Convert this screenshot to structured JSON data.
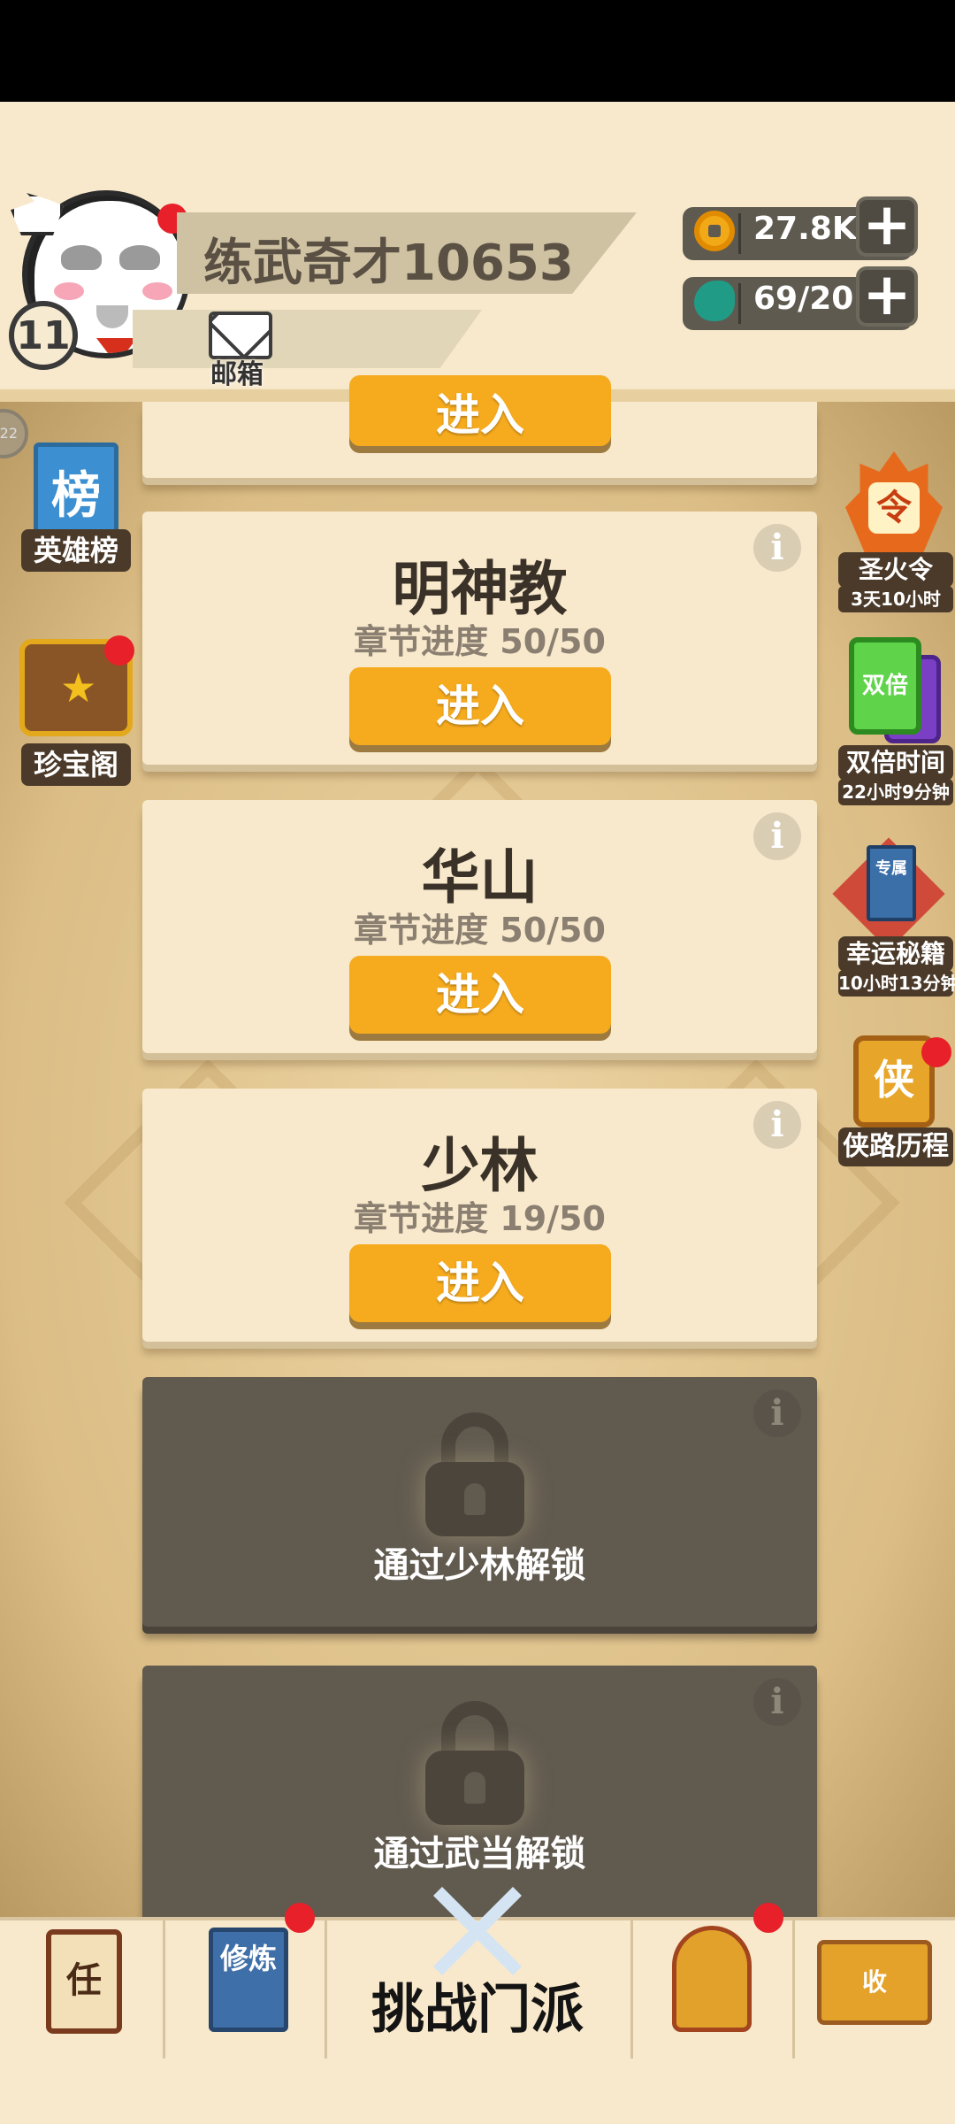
{
  "header": {
    "player_name": "练武奇才10653",
    "level": "11",
    "mailbox_label": "邮箱",
    "coins": "27.8K",
    "stamina": "69/20",
    "plus_label": "+"
  },
  "left_sidebar": [
    {
      "icon_text": "榜",
      "label": "英雄榜"
    },
    {
      "label": "珍宝阁"
    }
  ],
  "right_sidebar": [
    {
      "icon_text": "令",
      "label": "圣火令",
      "sub": "3天10小时"
    },
    {
      "icon_text": "双倍",
      "label": "双倍时间",
      "sub": "22小时9分钟"
    },
    {
      "icon_text": "专属",
      "label": "幸运秘籍",
      "sub": "10小时13分钟"
    },
    {
      "icon_text": "侠",
      "label": "侠路历程"
    }
  ],
  "side_scroll_tab": "22",
  "cards": {
    "partial_enter": "进入",
    "sects": [
      {
        "title": "明神教",
        "progress": "章节进度 50/50",
        "button": "进入"
      },
      {
        "title": "华山",
        "progress": "章节进度 50/50",
        "button": "进入"
      },
      {
        "title": "少林",
        "progress": "章节进度 19/50",
        "button": "进入"
      }
    ],
    "locked": [
      {
        "text": "通过少林解锁"
      },
      {
        "text": "通过武当解锁"
      }
    ],
    "info_glyph": "i"
  },
  "bottom_nav": {
    "task_icon_text": "任",
    "train_icon_text": "修炼",
    "challenge_label": "挑战门派",
    "collect_icon_text": "收"
  },
  "colors": {
    "accent_button": "#f6ab1e",
    "card_bg": "#f8e9cc",
    "locked_card_bg": "#615a4f",
    "notification_dot": "#e8202a"
  }
}
